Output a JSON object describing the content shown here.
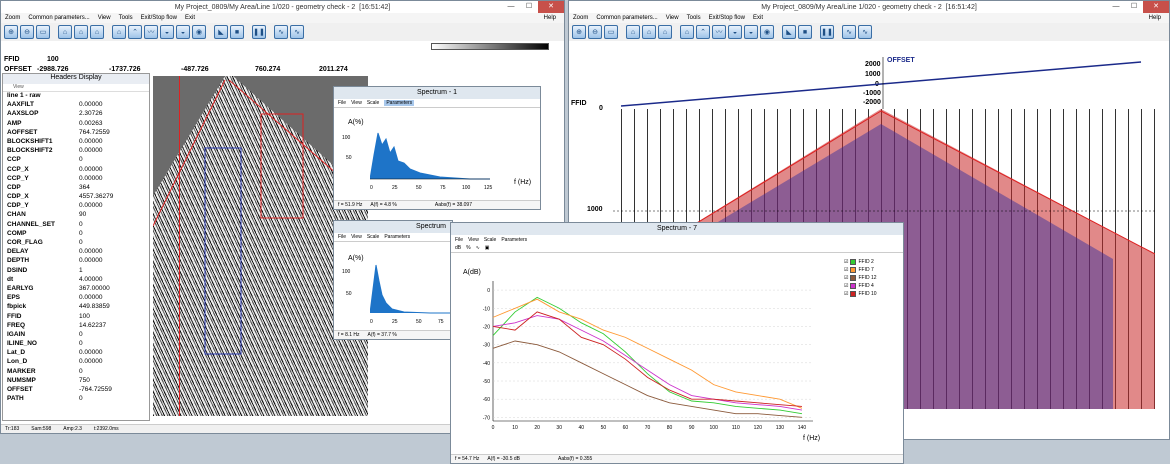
{
  "left_window": {
    "title": "My Project_0809/My Area/Line 1/020 - geometry check - 2",
    "time": "[16:51:42]",
    "menu": [
      "Zoom",
      "Common parameters...",
      "View",
      "Tools",
      "Exit/Stop flow",
      "Exit"
    ],
    "help": "Help",
    "ffid_label": "FFID",
    "ffid_value": "100",
    "offset_label": "OFFSET",
    "offsets": [
      "-2988.726",
      "-1737.726",
      "-487.726",
      "760.274",
      "2011.274"
    ],
    "status": [
      "Tr:183",
      "Sam:598",
      "Amp:2.3",
      "t:2392.0ms"
    ]
  },
  "headers_display": {
    "title": "Headers Display",
    "view": "View",
    "group": "line 1 - raw",
    "rows": [
      [
        "AAXFILT",
        "0.00000"
      ],
      [
        "AAXSLOP",
        "2.30726"
      ],
      [
        "AMP",
        "0.00263"
      ],
      [
        "AOFFSET",
        "764.72559"
      ],
      [
        "BLOCKSHIFT1",
        "0.00000"
      ],
      [
        "BLOCKSHIFT2",
        "0.00000"
      ],
      [
        "CCP",
        "0"
      ],
      [
        "CCP_X",
        "0.00000"
      ],
      [
        "CCP_Y",
        "0.00000"
      ],
      [
        "CDP",
        "364"
      ],
      [
        "CDP_X",
        "4557.36279"
      ],
      [
        "CDP_Y",
        "0.00000"
      ],
      [
        "CHAN",
        "90"
      ],
      [
        "CHANNEL_SET",
        "0"
      ],
      [
        "COMP",
        "0"
      ],
      [
        "COR_FLAG",
        "0"
      ],
      [
        "DELAY",
        "0.00000"
      ],
      [
        "DEPTH",
        "0.00000"
      ],
      [
        "DSIND",
        "1"
      ],
      [
        "dt",
        "4.00000"
      ],
      [
        "EARLYG",
        "367.00000"
      ],
      [
        "EPS",
        "0.00000"
      ],
      [
        "fbpick",
        "449.83859"
      ],
      [
        "FFID",
        "100"
      ],
      [
        "FREQ",
        "14.62237"
      ],
      [
        "IGAIN",
        "0"
      ],
      [
        "ILINE_NO",
        "0"
      ],
      [
        "Lat_D",
        "0.00000"
      ],
      [
        "Lon_D",
        "0.00000"
      ],
      [
        "MARKER",
        "0"
      ],
      [
        "NUMSMP",
        "750"
      ],
      [
        "OFFSET",
        "-764.72559"
      ],
      [
        "PATH",
        "0"
      ]
    ]
  },
  "right_window": {
    "title": "My Project_0809/My Area/Line 1/020 - geometry check - 2",
    "time": "[16:51:42]",
    "menu": [
      "Zoom",
      "Common parameters...",
      "View",
      "Tools",
      "Exit/Stop flow",
      "Exit"
    ],
    "help": "Help",
    "offset_label": "OFFSET",
    "offset_ticks": [
      "2000",
      "1000",
      "0",
      "-1000",
      "-2000"
    ],
    "ffid_label": "FFID",
    "time_ticks": [
      "0",
      "1000"
    ]
  },
  "spectrum1": {
    "title": "Spectrum - 1",
    "menu": [
      "File",
      "View",
      "Scale",
      "Parameters"
    ],
    "ylabel": "A(%)",
    "xlabel": "f (Hz)",
    "yticks": [
      "100",
      "50"
    ],
    "xticks": [
      "0",
      "25",
      "50",
      "75",
      "100",
      "125"
    ],
    "status": [
      "f = 51.9 Hz",
      "A(f) = 4.8 %",
      "Aabs(f) = 38.097"
    ]
  },
  "spectrum2": {
    "title": "Spectrum",
    "menu": [
      "File",
      "View",
      "Scale",
      "Parameters"
    ],
    "ylabel": "A(%)",
    "yticks": [
      "100",
      "50"
    ],
    "xticks": [
      "0",
      "25",
      "50",
      "75"
    ],
    "status": [
      "f = 8.1 Hz",
      "A(f) = 37.7 %"
    ]
  },
  "spectrum7": {
    "title": "Spectrum - 7",
    "menu": [
      "File",
      "View",
      "Scale",
      "Parameters"
    ],
    "ylabel": "A(dB)",
    "xlabel": "f (Hz)",
    "status": [
      "f = 54.7 Hz",
      "A(f) = -30.5 dB",
      "Aabs(f) = 0.355"
    ],
    "legend": [
      {
        "name": "FFID 2",
        "color": "#33cc33"
      },
      {
        "name": "FFID 7",
        "color": "#ff9933"
      },
      {
        "name": "FFID 12",
        "color": "#8b5a3c"
      },
      {
        "name": "FFID 4",
        "color": "#cc33cc"
      },
      {
        "name": "FFID 10",
        "color": "#cc2222"
      }
    ]
  },
  "chart_data": {
    "type": "line",
    "ylabel": "A(dB)",
    "xlabel": "f (Hz)",
    "xlim": [
      0,
      145
    ],
    "ylim": [
      -72,
      5
    ],
    "x": [
      0,
      10,
      20,
      30,
      40,
      50,
      60,
      70,
      80,
      90,
      100,
      110,
      120,
      130,
      140
    ],
    "series": [
      {
        "name": "FFID 2",
        "color": "#33cc33",
        "values": [
          -25,
          -12,
          -4,
          -10,
          -18,
          -24,
          -34,
          -46,
          -56,
          -61,
          -62,
          -64,
          -65,
          -66,
          -68
        ]
      },
      {
        "name": "FFID 7",
        "color": "#ff9933",
        "values": [
          -15,
          -10,
          -5,
          -12,
          -16,
          -22,
          -26,
          -32,
          -38,
          -44,
          -52,
          -56,
          -58,
          -60,
          -65
        ]
      },
      {
        "name": "FFID 12",
        "color": "#8b5a3c",
        "values": [
          -32,
          -28,
          -30,
          -34,
          -40,
          -46,
          -52,
          -58,
          -62,
          -64,
          -66,
          -68,
          -68,
          -69,
          -70
        ]
      },
      {
        "name": "FFID 4",
        "color": "#cc33cc",
        "values": [
          -20,
          -18,
          -14,
          -16,
          -22,
          -28,
          -36,
          -44,
          -52,
          -58,
          -60,
          -62,
          -63,
          -64,
          -66
        ]
      },
      {
        "name": "FFID 10",
        "color": "#cc2222",
        "values": [
          -20,
          -22,
          -12,
          -16,
          -26,
          -30,
          -38,
          -48,
          -55,
          -60,
          -60,
          -61,
          -62,
          -63,
          -64
        ]
      }
    ],
    "yticks": [
      "0",
      "-10",
      "-20",
      "-30",
      "-40",
      "-50",
      "-60",
      "-70"
    ],
    "xticks": [
      "0",
      "10",
      "20",
      "30",
      "40",
      "50",
      "60",
      "70",
      "80",
      "90",
      "100",
      "110",
      "120",
      "130",
      "140"
    ]
  }
}
